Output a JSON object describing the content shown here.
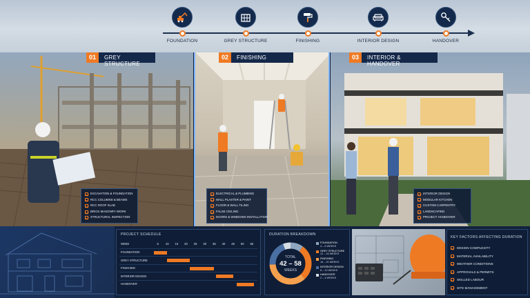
{
  "timeline": {
    "stages": [
      {
        "label": "FOUNDATION",
        "icon": "excavator-icon"
      },
      {
        "label": "GREY STRUCTURE",
        "icon": "building-structure-icon"
      },
      {
        "label": "FINISHING",
        "icon": "paint-roller-icon"
      },
      {
        "label": "INTERIOR DESIGN",
        "icon": "sofa-icon"
      },
      {
        "label": "HANDOVER",
        "icon": "key-icon"
      }
    ]
  },
  "panels": [
    {
      "number": "01",
      "title": "GREY STRUCTURE",
      "checklist": [
        "EXCAVATION & FOUNDATION",
        "RCC COLUMNS & BEAMS",
        "RCC ROOF SLAB",
        "BRICK MASONRY WORK",
        "STRUCTURAL INSPECTION"
      ]
    },
    {
      "number": "02",
      "title": "FINISHING",
      "checklist": [
        "ELECTRICAL & PLUMBING",
        "WALL PLASTER & PAINT",
        "FLOOR & WALL TILING",
        "FALSE CEILING",
        "DOORS & WINDOWS INSTALLATION"
      ]
    },
    {
      "number": "03",
      "title": "INTERIOR & HANDOVER",
      "checklist": [
        "INTERIOR DESIGN",
        "MODULAR KITCHEN",
        "CUSTOM CARPENTRY",
        "LANDSCAPING",
        "PROJECT HANDOVER"
      ]
    }
  ],
  "schedule": {
    "title": "PROJECT SCHEDULE",
    "week_label": "WEEK",
    "weeks": [
      5,
      10,
      15,
      20,
      25,
      30,
      35,
      40,
      45,
      50,
      55
    ],
    "week_range": [
      0,
      58
    ],
    "rows": [
      {
        "label": "FOUNDATION",
        "start": 3,
        "end": 10
      },
      {
        "label": "GREY STRUCTURE",
        "start": 10,
        "end": 22
      },
      {
        "label": "FINISHING",
        "start": 22,
        "end": 35
      },
      {
        "label": "INTERIOR DESIGN",
        "start": 36,
        "end": 45
      },
      {
        "label": "HANDOVER",
        "start": 47,
        "end": 56
      }
    ]
  },
  "duration": {
    "title": "DURATION BREAKDOWN",
    "total_label": "TOTAL",
    "total_value": "42 – 58",
    "total_unit": "WEEKS",
    "items": [
      {
        "label": "FOUNDATION",
        "value": "4 – 6 WEEKS",
        "weeks": 5,
        "color": "#8fa6c0"
      },
      {
        "label": "GREY STRUCTURE",
        "value": "12 – 16 WEEKS",
        "weeks": 14,
        "color": "#ef7a24"
      },
      {
        "label": "FINISHING",
        "value": "16 – 20 WEEKS",
        "weeks": 18,
        "color": "#f4a04e"
      },
      {
        "label": "INTERIOR DESIGN",
        "value": "8 – 12 WEEKS",
        "weeks": 10,
        "color": "#4a6fa3"
      },
      {
        "label": "HANDOVER",
        "value": "2 – 4 WEEKS",
        "weeks": 3,
        "color": "#d6dde6"
      }
    ]
  },
  "factors": {
    "title": "KEY FACTORS AFFECTING DURATION",
    "items": [
      "DESIGN COMPLEXITY",
      "MATERIAL AVAILABILITY",
      "WEATHER CONDITIONS",
      "APPROVALS & PERMITS",
      "SKILLED LABOUR",
      "SITE MANAGEMENT"
    ]
  },
  "colors": {
    "accent": "#ef7a24",
    "navy": "#14284a"
  }
}
